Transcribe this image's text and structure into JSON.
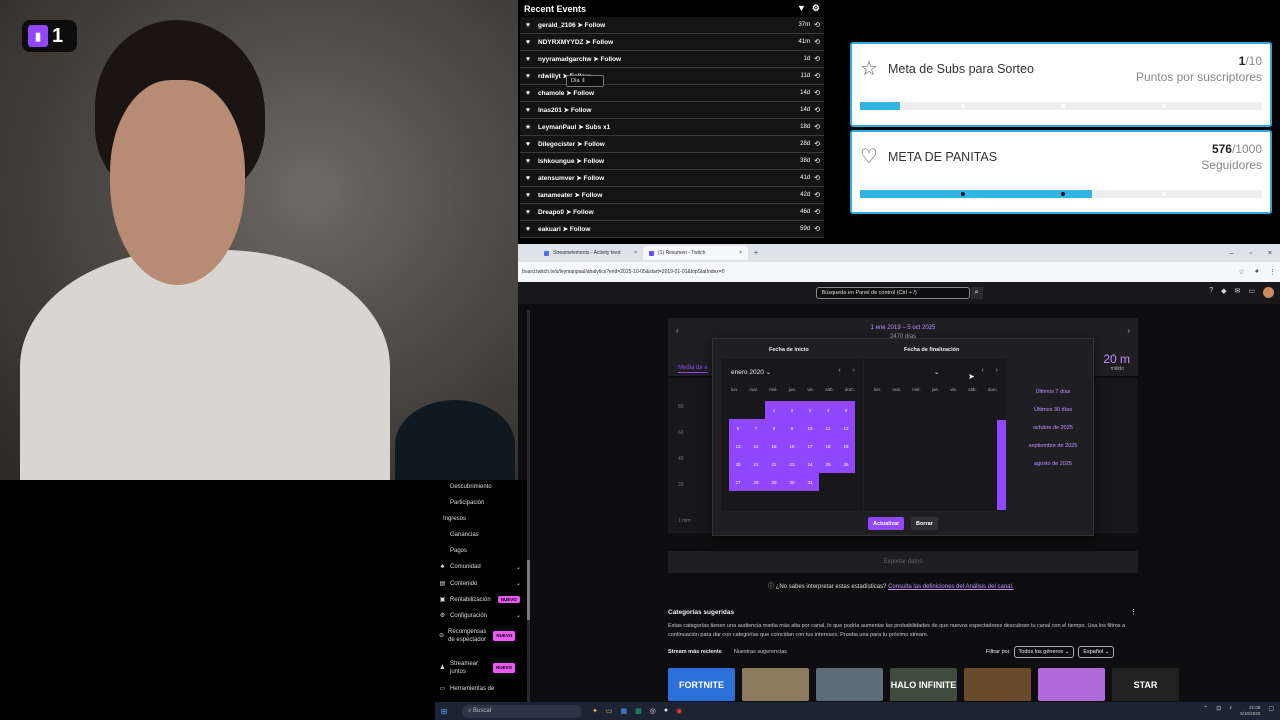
{
  "webcam": {
    "badge_count": "1"
  },
  "events": {
    "title": "Recent Events",
    "items": [
      {
        "text": "gerald_2106 ➤ Follow",
        "time": "37m",
        "icon": "heart-icon"
      },
      {
        "text": "NDYRXMYYDZ ➤ Follow",
        "time": "41m",
        "icon": "heart-icon"
      },
      {
        "text": "nyyramadgarchw ➤ Follow",
        "time": "1d",
        "icon": "heart-icon"
      },
      {
        "text": "rdwillyt ➤ Follow",
        "time": "11d",
        "icon": "heart-icon"
      },
      {
        "text": "chamole ➤ Follow",
        "time": "14d",
        "icon": "heart-icon"
      },
      {
        "text": "lnas201 ➤ Follow",
        "time": "14d",
        "icon": "heart-icon"
      },
      {
        "text": "LeymanPaul ➤ Subs x1",
        "time": "18d",
        "icon": "star-icon"
      },
      {
        "text": "Dilegocister ➤ Follow",
        "time": "28d",
        "icon": "heart-icon"
      },
      {
        "text": "Ishkoungue ➤ Follow",
        "time": "38d",
        "icon": "heart-icon"
      },
      {
        "text": "atensumver ➤ Follow",
        "time": "41d",
        "icon": "heart-icon"
      },
      {
        "text": "tanameater ➤ Follow",
        "time": "42d",
        "icon": "heart-icon"
      },
      {
        "text": "Dreapo0 ➤ Follow",
        "time": "46d",
        "icon": "heart-icon"
      },
      {
        "text": "eakuari ➤ Follow",
        "time": "59d",
        "icon": "heart-icon"
      }
    ]
  },
  "goals": {
    "subs": {
      "title": "Meta de Subs para Sorteo",
      "current": "1",
      "target": "/10",
      "subtitle": "Puntos por suscriptores",
      "progress": 0.1
    },
    "panitas": {
      "title": "META DE PANITAS",
      "current": "576",
      "target": "/1000",
      "subtitle": "Seguidores",
      "progress": 0.576
    }
  },
  "browser": {
    "tabs": [
      {
        "label": "Streamelements - Activity feed"
      },
      {
        "label": "(1) Resumen - Twitch"
      }
    ],
    "url": "board.twitch.tv/u/leymanpaul/analytics?end=2025-10-05&start=2019-01-01&topStatIndex=0",
    "search_placeholder": "Búsqueda en Panel de control (Ctrl + /)"
  },
  "sidebar": {
    "items": [
      {
        "label": "Descubrimiento"
      },
      {
        "label": "Participación"
      },
      {
        "label": "Ingresos"
      },
      {
        "label": "Ganancias"
      },
      {
        "label": "Pagos"
      },
      {
        "label": "Comunidad"
      },
      {
        "label": "Contenido"
      },
      {
        "label": "Rentabilización"
      },
      {
        "label": "Configuración"
      },
      {
        "label": "Recompensas de espectador"
      },
      {
        "label": "Streamear juntos"
      },
      {
        "label": "Herramientas de"
      }
    ],
    "badge_new": "NUEVO"
  },
  "analytics": {
    "range": "1 ene 2019 – 5 oct 2025",
    "days": "2470 días",
    "metric_label": "Media de e",
    "right_value": "20 m",
    "right_caption": "mitido",
    "y_ticks": [
      "80",
      "60",
      "40",
      "20",
      "1 mm"
    ],
    "day_select": "Día",
    "export": "Exportar datos",
    "help_text": "¿No sabes interpretar estas estadísticas?",
    "help_link": "Consulta las definiciones del Análisis del canal."
  },
  "picker": {
    "start_heading": "Fecha de inicio",
    "end_heading": "Fecha de finalización",
    "start_month": "enero 2020",
    "weekdays": [
      "lun.",
      "mar.",
      "mié.",
      "jue.",
      "vie.",
      "sáb.",
      "dom."
    ],
    "start_days": [
      "",
      "",
      "1",
      "2",
      "3",
      "4",
      "5",
      "6",
      "7",
      "8",
      "9",
      "10",
      "11",
      "12",
      "13",
      "14",
      "15",
      "16",
      "17",
      "18",
      "19",
      "20",
      "21",
      "22",
      "23",
      "24",
      "25",
      "26",
      "27",
      "28",
      "29",
      "30",
      "31"
    ],
    "presets": [
      "Últimos 7 días",
      "Últimos 30 días",
      "octubre de 2025",
      "septiembre de 2025",
      "agosto de 2025"
    ],
    "update": "Actualizar",
    "clear": "Borrar"
  },
  "categories": {
    "title": "Categorías sugeridas",
    "description": "Estas categorías tienen una audiencia media más alta por canal, lo que podría aumentar las probabilidades de que nuevos espectadores descubran tu canal con el tiempo. Usa los filtros a continuación para dar con categorías que coincidan con tus intereses. Prueba una para tu próximo stream.",
    "tab_recent": "Stream más reciente",
    "tab_suggestions": "Nuestras sugerencias",
    "filter_label": "Filtrar por",
    "genre": "Todos los géneros",
    "language": "Español",
    "thumbs": [
      {
        "label": "FORTNITE",
        "color": "#2d6fd8"
      },
      {
        "label": "",
        "color": "#8b7a5e"
      },
      {
        "label": "",
        "color": "#5d6a78"
      },
      {
        "label": "HALO INFINITE",
        "color": "#3d4a3c"
      },
      {
        "label": "",
        "color": "#6a4a2a"
      },
      {
        "label": "",
        "color": "#b36ad9"
      },
      {
        "label": "STAR",
        "color": "#222222"
      }
    ]
  },
  "taskbar": {
    "search": "Buscar",
    "time": "21:08",
    "date": "5/10/2025"
  }
}
